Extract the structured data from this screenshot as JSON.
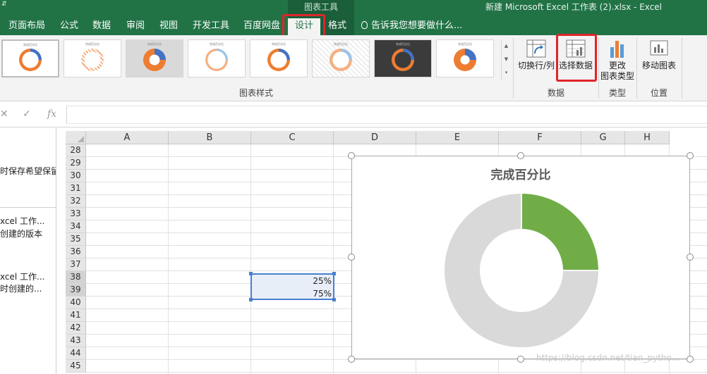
{
  "title_bar": {
    "contextual_group": "图表工具",
    "document_title": "新建 Microsoft Excel 工作表 (2).xlsx - Excel",
    "qat_arrow": "⇵"
  },
  "ribbon_tabs": [
    {
      "label": "页面布局",
      "active": false
    },
    {
      "label": "公式",
      "active": false
    },
    {
      "label": "数据",
      "active": false
    },
    {
      "label": "审阅",
      "active": false
    },
    {
      "label": "视图",
      "active": false
    },
    {
      "label": "开发工具",
      "active": false
    },
    {
      "label": "百度网盘",
      "active": false
    },
    {
      "label": "设计",
      "active": true
    },
    {
      "label": "格式",
      "active": false
    }
  ],
  "tell_me": "告诉我您想要做什么...",
  "chart_styles": {
    "group_label": "图表样式",
    "thumb_title": "完成百分比"
  },
  "data_group": {
    "label": "数据",
    "switch_row_col": "切换行/列",
    "select_data": "选择数据"
  },
  "type_group": {
    "label": "类型",
    "change_type_line1": "更改",
    "change_type_line2": "图表类型"
  },
  "location_group": {
    "label": "位置",
    "move_chart": "移动图表"
  },
  "formula_bar": {
    "cancel": "✕",
    "enter": "✓",
    "fx": "fx",
    "content": ""
  },
  "left_pane": {
    "line1": "时保存希望保留",
    "line2": "xcel 工作...",
    "line3": "创建的版本",
    "line4": "xcel 工作...",
    "line5": "时创建的..."
  },
  "columns": [
    "A",
    "B",
    "C",
    "D",
    "E",
    "F",
    "G",
    "H"
  ],
  "rows": [
    "28",
    "29",
    "30",
    "31",
    "32",
    "33",
    "34",
    "35",
    "36",
    "37",
    "38",
    "39",
    "40",
    "41",
    "42",
    "43",
    "44",
    "45"
  ],
  "cells": {
    "C38": "25%",
    "C39": "75%"
  },
  "colors": {
    "excel_green": "#217346",
    "highlight_red": "#e0242a",
    "series_complete": "#70ad47",
    "series_remaining": "#d9d9d9"
  },
  "chart_data": {
    "type": "pie",
    "variant": "doughnut",
    "title": "完成百分比",
    "values": [
      25,
      75
    ],
    "colors": [
      "#70ad47",
      "#d9d9d9"
    ]
  },
  "watermark": "https://blog.csdn.net/tian_pytho..."
}
